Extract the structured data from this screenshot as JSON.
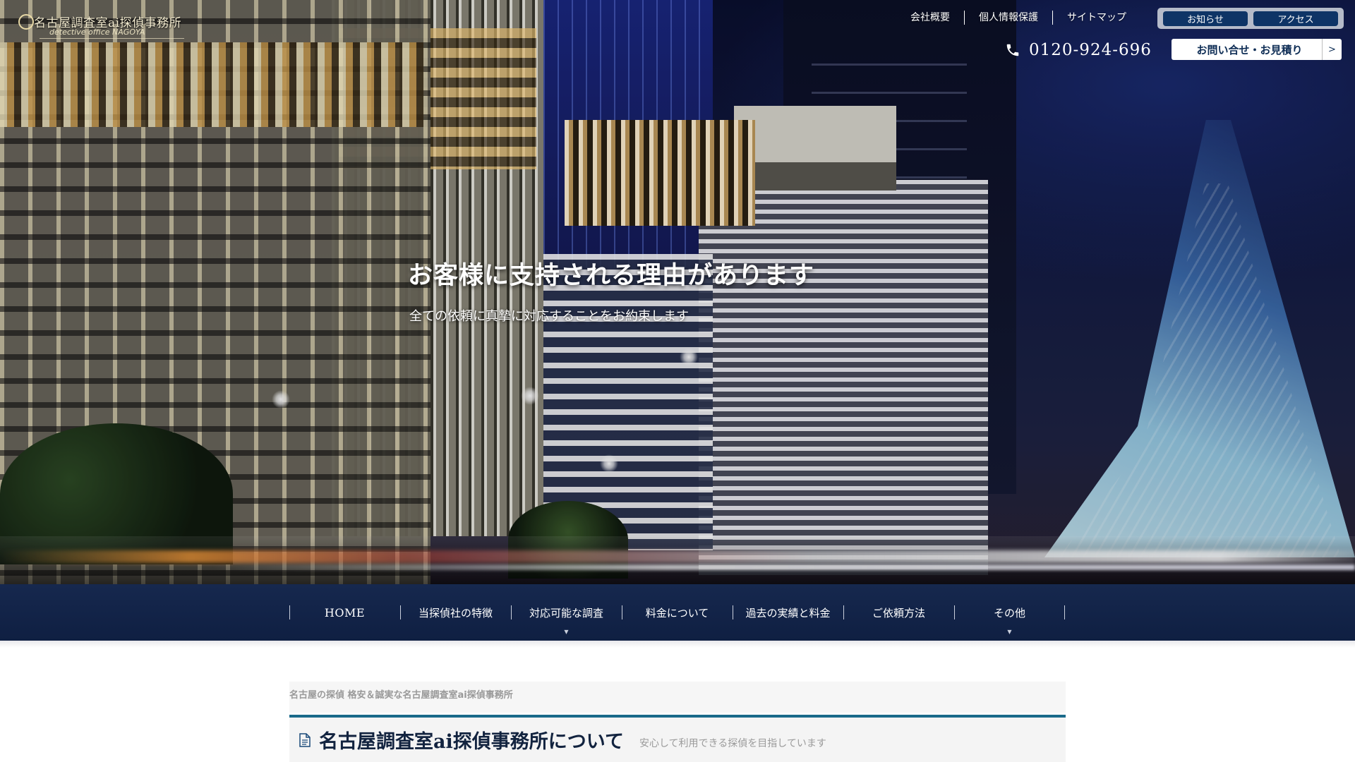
{
  "brand": {
    "title": "名古屋調査室ai探偵事務所",
    "subtitle": "detective office NAGOYA"
  },
  "utility_links": [
    "会社概要",
    "個人情報保護",
    "サイトマップ"
  ],
  "pill_buttons": [
    "お知らせ",
    "アクセス"
  ],
  "phone": {
    "icon": "phone-icon",
    "number": "0120-924-696"
  },
  "contact_button": {
    "label": "お問い合せ・お見積り",
    "arrow": ">"
  },
  "hero": {
    "title": "お客様に支持される理由があります",
    "subtitle": "全ての依頼に真摯に対応することをお約束します"
  },
  "nav": {
    "items": [
      {
        "label": "HOME",
        "has_dropdown": false
      },
      {
        "label": "当探偵社の特徴",
        "has_dropdown": false
      },
      {
        "label": "対応可能な調査",
        "has_dropdown": true
      },
      {
        "label": "料金について",
        "has_dropdown": false
      },
      {
        "label": "過去の実績と料金",
        "has_dropdown": false
      },
      {
        "label": "ご依頼方法",
        "has_dropdown": false
      },
      {
        "label": "その他",
        "has_dropdown": true
      }
    ],
    "caret": "▼"
  },
  "breadcrumb": "名古屋の探偵 格安＆誠実な名古屋調査室ai探偵事務所",
  "section": {
    "icon": "document-icon",
    "title": "名古屋調査室ai探偵事務所について",
    "subtitle": "安心して利用できる探偵を目指しています"
  },
  "colors": {
    "navy": "#0f1f42",
    "pill_blue": "#0e3466",
    "accent_rule": "#1a6a8a",
    "contact_text": "#0e2d55"
  }
}
